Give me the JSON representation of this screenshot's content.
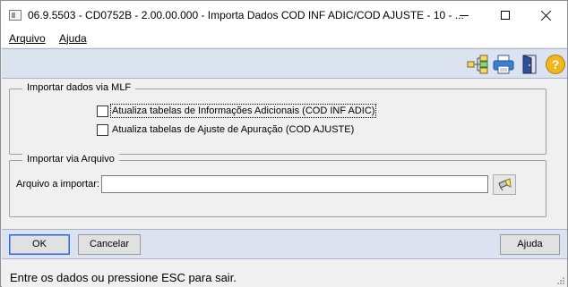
{
  "window": {
    "title": "06.9.5503 - CD0752B - 2.00.00.000 - Importa Dados COD INF ADIC/COD AJUSTE - 10 - ..."
  },
  "menu": {
    "items": [
      {
        "label": "Arquivo"
      },
      {
        "label": "Ajuda"
      }
    ]
  },
  "toolbar": {
    "icons": [
      "tree-structure-icon",
      "printer-icon",
      "exit-door-icon",
      "help-icon"
    ]
  },
  "mlf_group": {
    "legend": "Importar dados via MLF",
    "options": [
      {
        "label": "Atualiza tabelas de Informações Adicionais (COD INF ADIC)",
        "checked": false
      },
      {
        "label": "Atualiza tabelas de Ajuste de Apuração (COD AJUSTE)",
        "checked": false
      }
    ]
  },
  "file_group": {
    "legend": "Importar via Arquivo",
    "field_label": "Arquivo a importar:",
    "field_value": ""
  },
  "buttons": {
    "ok": "OK",
    "cancel": "Cancelar",
    "help": "Ajuda"
  },
  "status": {
    "text": "Entre os dados ou pressione ESC para sair."
  },
  "colors": {
    "toolbar_bg": "#dbe3f0",
    "window_bg": "#f0f0f0",
    "help_icon": "#f2b51c"
  }
}
